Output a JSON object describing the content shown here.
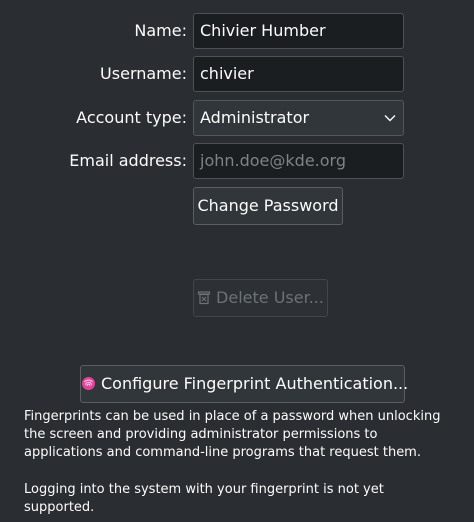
{
  "form": {
    "name_label": "Name:",
    "name_value": "Chivier Humber",
    "username_label": "Username:",
    "username_value": "chivier",
    "account_type_label": "Account type:",
    "account_type_value": "Administrator",
    "email_label": "Email address:",
    "email_placeholder": "john.doe@kde.org"
  },
  "buttons": {
    "change_password": "Change Password",
    "delete_user": "Delete User...",
    "delete_user_enabled": false,
    "configure_fingerprint": "Configure Fingerprint Authentication..."
  },
  "icons": {
    "delete_user": "trash-icon",
    "fingerprint": "fingerprint-icon",
    "account_type_dropdown": "chevron-down-icon"
  },
  "info": {
    "fingerprint_description": "Fingerprints can be used in place of a password when unlocking the screen and providing administrator permissions to applications and command-line programs that request them.",
    "fingerprint_login_note": "Logging into the system with your fingerprint is not yet supported."
  },
  "colors": {
    "background": "#2a2e32",
    "field_background": "#1b1e20",
    "button_background": "#31363b",
    "fingerprint_accent": "#e0459a"
  }
}
